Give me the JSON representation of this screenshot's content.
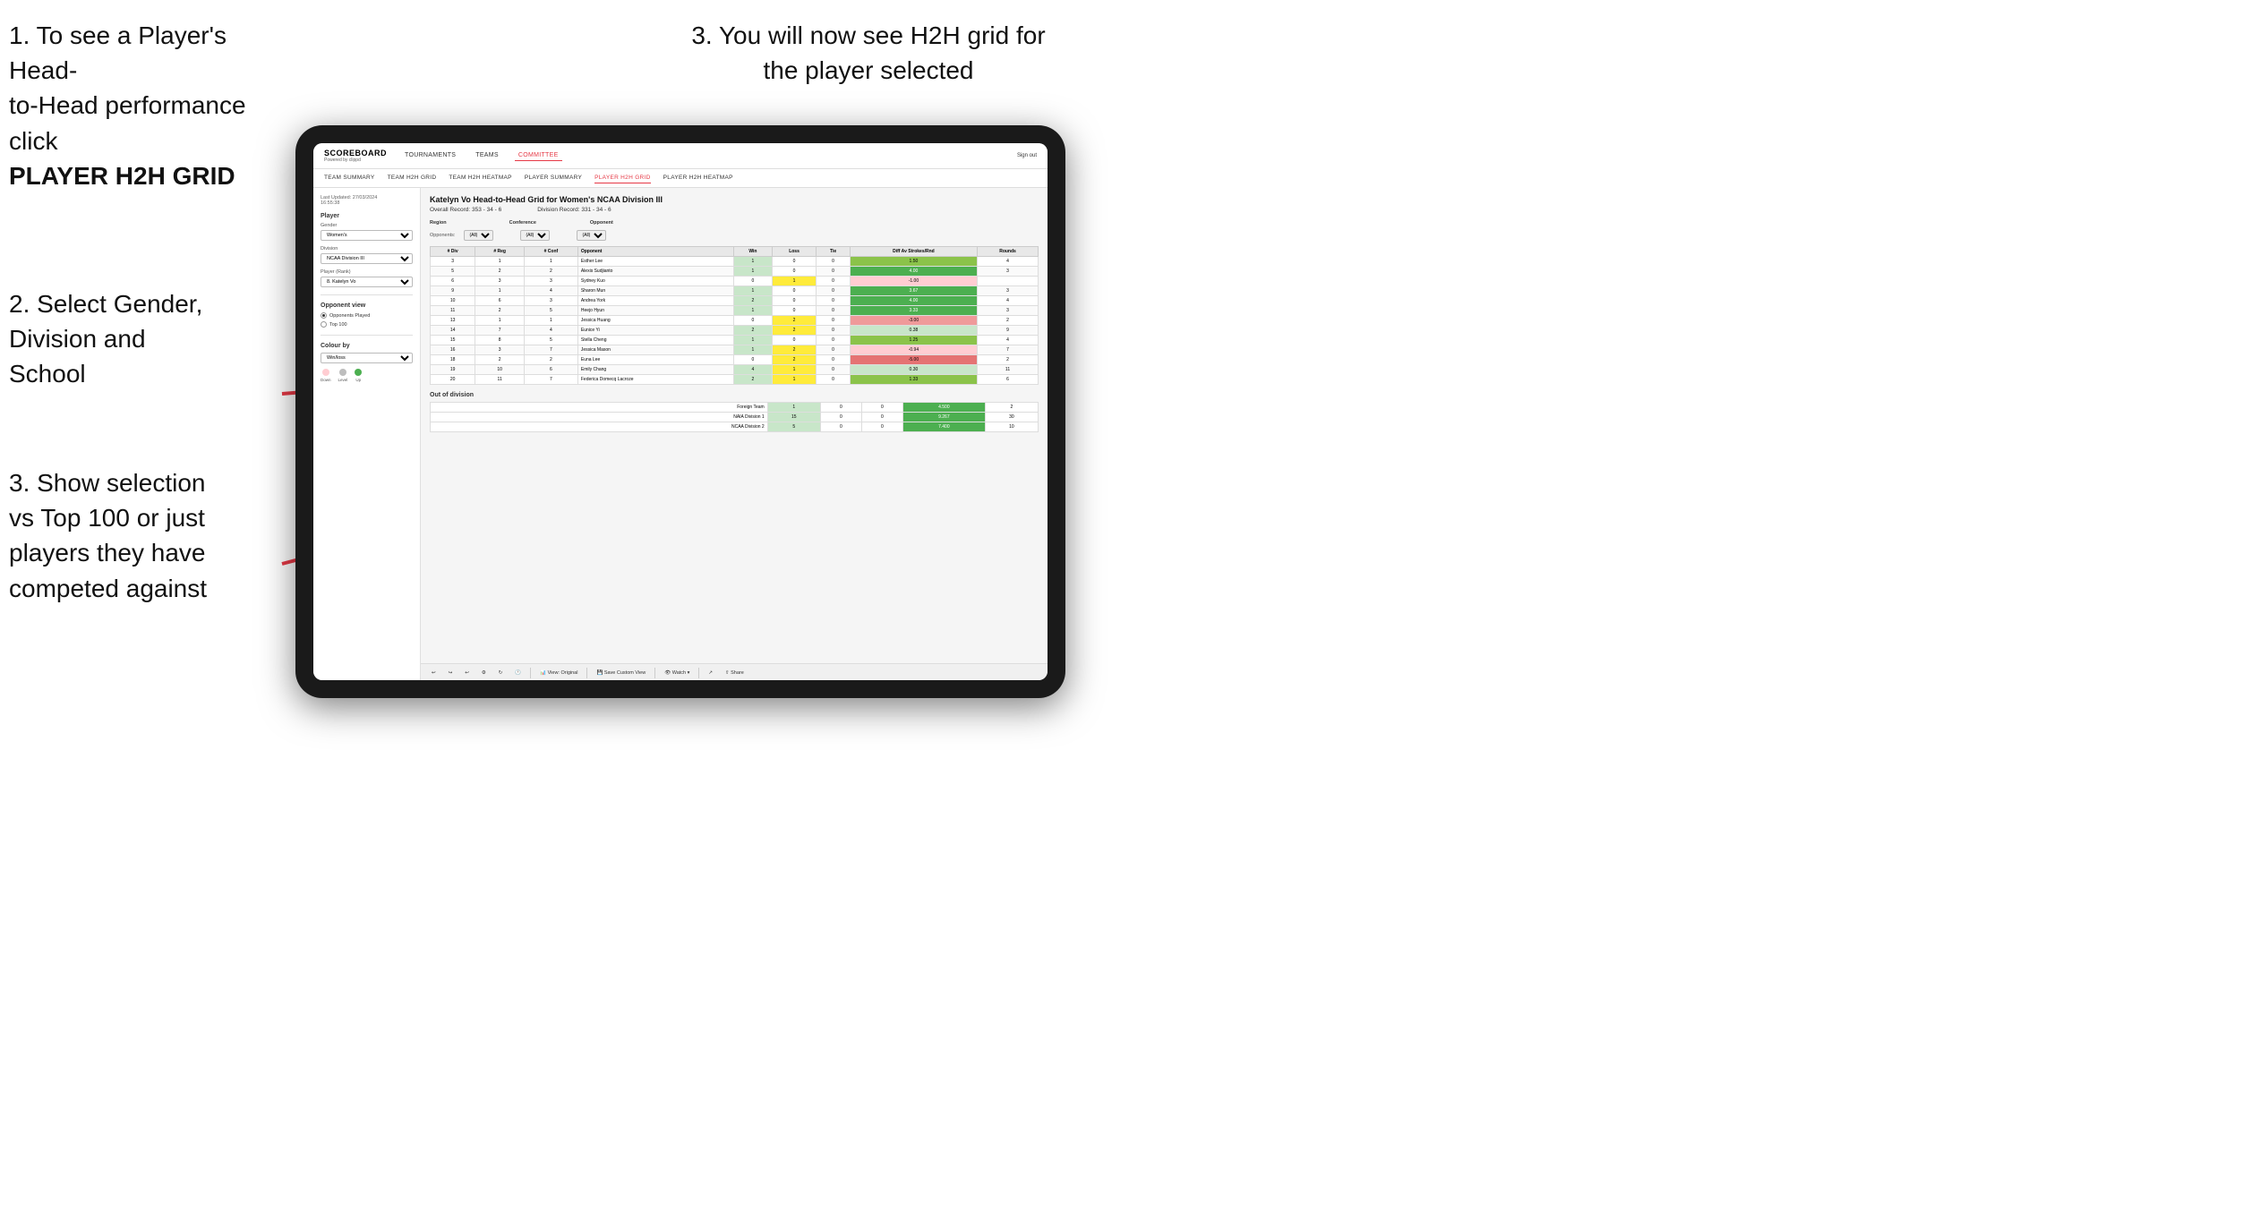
{
  "instructions": {
    "top_left_line1": "1. To see a Player's Head-",
    "top_left_line2": "to-Head performance click",
    "top_left_bold": "PLAYER H2H GRID",
    "top_right": "3. You will now see H2H grid for the player selected",
    "mid_left_line1": "2. Select Gender,",
    "mid_left_line2": "Division and",
    "mid_left_line3": "School",
    "bottom_left_line1": "3. Show selection",
    "bottom_left_line2": "vs Top 100 or just",
    "bottom_left_line3": "players they have",
    "bottom_left_line4": "competed against"
  },
  "app": {
    "logo": "SCOREBOARD",
    "logo_sub": "Powered by clippd",
    "sign_out": "Sign out",
    "nav": [
      "TOURNAMENTS",
      "TEAMS",
      "COMMITTEE"
    ],
    "nav_active": "COMMITTEE",
    "sub_nav": [
      "TEAM SUMMARY",
      "TEAM H2H GRID",
      "TEAM H2H HEATMAP",
      "PLAYER SUMMARY",
      "PLAYER H2H GRID",
      "PLAYER H2H HEATMAP"
    ],
    "sub_nav_active": "PLAYER H2H GRID"
  },
  "sidebar": {
    "timestamp_label": "Last Updated: 27/03/2024",
    "timestamp_time": "16:55:38",
    "player_section": "Player",
    "gender_label": "Gender",
    "gender_value": "Women's",
    "division_label": "Division",
    "division_value": "NCAA Division III",
    "player_rank_label": "Player (Rank)",
    "player_rank_value": "8. Katelyn Vo",
    "opponent_view_title": "Opponent view",
    "radio_options": [
      "Opponents Played",
      "Top 100"
    ],
    "radio_selected": "Opponents Played",
    "colour_by_title": "Colour by",
    "colour_by_value": "Win/loss",
    "legend": [
      {
        "label": "Down",
        "color": "#ffcdd2"
      },
      {
        "label": "Level",
        "color": "#e0e0e0"
      },
      {
        "label": "Up",
        "color": "#4caf50"
      }
    ]
  },
  "main": {
    "title": "Katelyn Vo Head-to-Head Grid for Women's NCAA Division III",
    "overall_record": "Overall Record: 353 - 34 - 6",
    "division_record": "Division Record: 331 - 34 - 6",
    "region_label": "Region",
    "conference_label": "Conference",
    "opponent_label": "Opponent",
    "opponents_label": "Opponents:",
    "filter_all": "(All)",
    "table_headers": [
      "# Div",
      "# Reg",
      "# Conf",
      "Opponent",
      "Win",
      "Loss",
      "Tie",
      "Diff Av Strokes/Rnd",
      "Rounds"
    ],
    "rows": [
      {
        "div": 3,
        "reg": 1,
        "conf": 1,
        "opponent": "Esther Lee",
        "win": 1,
        "loss": 0,
        "tie": 0,
        "diff": "1.50",
        "rounds": 4,
        "win_color": "green",
        "loss_color": "",
        "tie_color": ""
      },
      {
        "div": 5,
        "reg": 2,
        "conf": 2,
        "opponent": "Alexis Sudjianto",
        "win": 1,
        "loss": 0,
        "tie": 0,
        "diff": "4.00",
        "rounds": 3,
        "win_color": "green"
      },
      {
        "div": 6,
        "reg": 3,
        "conf": 3,
        "opponent": "Sydney Kuo",
        "win": 0,
        "loss": 1,
        "tie": 0,
        "diff": "-1.00",
        "rounds": "",
        "win_color": "",
        "loss_color": "yellow"
      },
      {
        "div": 9,
        "reg": 1,
        "conf": 4,
        "opponent": "Sharon Mun",
        "win": 1,
        "loss": 0,
        "tie": 0,
        "diff": "3.67",
        "rounds": 3,
        "win_color": "green"
      },
      {
        "div": 10,
        "reg": 6,
        "conf": 3,
        "opponent": "Andrea York",
        "win": 2,
        "loss": 0,
        "tie": 0,
        "diff": "4.00",
        "rounds": 4,
        "win_color": "green"
      },
      {
        "div": 11,
        "reg": 2,
        "conf": 5,
        "opponent": "Heejo Hyun",
        "win": 1,
        "loss": 0,
        "tie": 0,
        "diff": "3.33",
        "rounds": 3,
        "win_color": "green"
      },
      {
        "div": 13,
        "reg": 1,
        "conf": 1,
        "opponent": "Jessica Huang",
        "win": 0,
        "loss": 2,
        "tie": 0,
        "diff": "-3.00",
        "rounds": 2,
        "loss_color": "yellow"
      },
      {
        "div": 14,
        "reg": 7,
        "conf": 4,
        "opponent": "Eunice Yi",
        "win": 2,
        "loss": 2,
        "tie": 0,
        "diff": "0.38",
        "rounds": 9,
        "win_color": "green",
        "loss_color": "yellow"
      },
      {
        "div": 15,
        "reg": 8,
        "conf": 5,
        "opponent": "Stella Cheng",
        "win": 1,
        "loss": 0,
        "tie": 0,
        "diff": "1.25",
        "rounds": 4,
        "win_color": "green"
      },
      {
        "div": 16,
        "reg": 3,
        "conf": 7,
        "opponent": "Jessica Mason",
        "win": 1,
        "loss": 2,
        "tie": 0,
        "diff": "-0.94",
        "rounds": 7,
        "win_color": "green",
        "loss_color": "yellow"
      },
      {
        "div": 18,
        "reg": 2,
        "conf": 2,
        "opponent": "Euna Lee",
        "win": 0,
        "loss": 2,
        "tie": 0,
        "diff": "-5.00",
        "rounds": 2,
        "loss_color": "red"
      },
      {
        "div": 19,
        "reg": 10,
        "conf": 6,
        "opponent": "Emily Chang",
        "win": 4,
        "loss": 1,
        "tie": 0,
        "diff": "0.30",
        "rounds": 11,
        "win_color": "green"
      },
      {
        "div": 20,
        "reg": 11,
        "conf": 7,
        "opponent": "Federica Domecq Lacroze",
        "win": 2,
        "loss": 1,
        "tie": 0,
        "diff": "1.33",
        "rounds": 6,
        "win_color": "green"
      }
    ],
    "out_of_division": "Out of division",
    "out_rows": [
      {
        "team": "Foreign Team",
        "win": 1,
        "loss": 0,
        "tie": 0,
        "diff": "4.500",
        "rounds": 2
      },
      {
        "team": "NAIA Division 1",
        "win": 15,
        "loss": 0,
        "tie": 0,
        "diff": "9.267",
        "rounds": 30
      },
      {
        "team": "NCAA Division 2",
        "win": 5,
        "loss": 0,
        "tie": 0,
        "diff": "7.400",
        "rounds": 10
      }
    ]
  },
  "toolbar": {
    "view_original": "View: Original",
    "save_custom": "Save Custom View",
    "watch": "Watch",
    "share": "Share"
  }
}
